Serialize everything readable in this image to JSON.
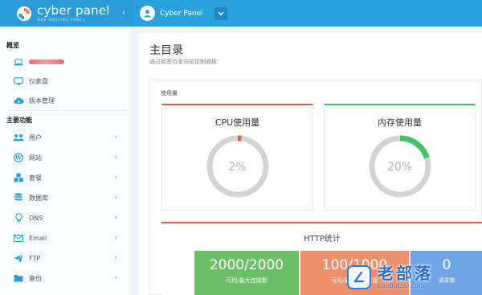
{
  "brand": {
    "name": "cyber panel",
    "subtitle": "WEB HOSTING PANEL",
    "collapse_icon": "‹"
  },
  "header": {
    "username": "Cyber Panel",
    "dropdown_icon": "chevron-down-icon"
  },
  "sidebar": {
    "overview_title": "概览",
    "overview_items": [
      {
        "label": "",
        "icon": "laptop-icon"
      },
      {
        "label": "仪表盘",
        "icon": "monitor-icon"
      },
      {
        "label": "版本管理",
        "icon": "cloud-icon"
      }
    ],
    "main_title": "主要功能",
    "main_items": [
      {
        "label": "用户",
        "icon": "users-icon"
      },
      {
        "label": "网站",
        "icon": "wordpress-icon"
      },
      {
        "label": "套餐",
        "icon": "cubes-icon"
      },
      {
        "label": "数据库",
        "icon": "database-icon"
      },
      {
        "label": "DNS",
        "icon": "bulb-icon"
      },
      {
        "label": "Email",
        "icon": "envelope-icon"
      },
      {
        "label": "FTP",
        "icon": "paper-plane-icon"
      },
      {
        "label": "备份",
        "icon": "folder-icon"
      }
    ],
    "arrow": "›"
  },
  "main": {
    "title": "主目录",
    "subtitle": "通过标签页来浏览控制面板",
    "usage_label": "使用量",
    "cpu": {
      "title": "CPU使用量",
      "percent_text": "2%",
      "percent": 2,
      "color": "#e05a5a"
    },
    "memory": {
      "title": "内存使用量",
      "percent_text": "20%",
      "percent": 20,
      "color": "#43c26a"
    },
    "http": {
      "title": "HTTP统计",
      "stats": [
        {
          "value": "2000/2000",
          "caption": "可用/最大连接数"
        },
        {
          "value": "100/1000",
          "caption": "可用/最大空闲连接"
        },
        {
          "value": "0",
          "caption": "请求数"
        }
      ]
    }
  },
  "watermark": {
    "text_cn": "老部落",
    "text_en": "LaoBuLuo.com"
  },
  "colors": {
    "accent": "#2b9bd9",
    "header": "#2aa1dc",
    "green": "#6dbf6a",
    "orange": "#ef8f6b",
    "blue": "#6fa6e6",
    "red": "#e05a5a"
  }
}
